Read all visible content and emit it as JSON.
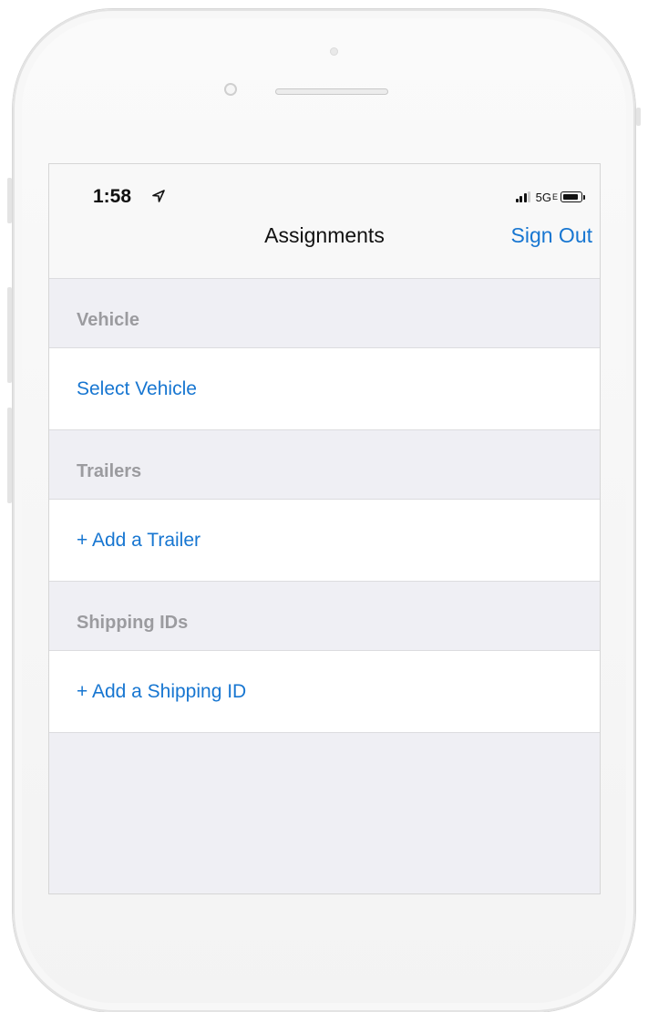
{
  "status_bar": {
    "time": "1:58",
    "network": "5G",
    "network_suffix": "E"
  },
  "nav": {
    "title": "Assignments",
    "action_label": "Sign Out"
  },
  "sections": [
    {
      "header": "Vehicle",
      "action": "Select Vehicle"
    },
    {
      "header": "Trailers",
      "action": "+ Add a Trailer"
    },
    {
      "header": "Shipping IDs",
      "action": "+ Add a Shipping ID"
    }
  ],
  "colors": {
    "accent": "#1776d1",
    "section_header_text": "#9b9b9f",
    "group_background": "#efeff4"
  }
}
